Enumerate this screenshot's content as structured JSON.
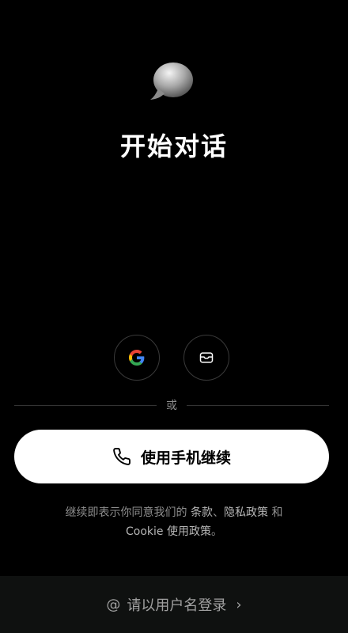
{
  "app": {
    "logo_icon": "chat-bubble-icon",
    "title": "开始对话"
  },
  "social": {
    "google_icon": "google-g-icon",
    "email_icon": "mail-icon"
  },
  "divider": {
    "text": "或"
  },
  "phone_button": {
    "icon": "phone-icon",
    "label": "使用手机继续"
  },
  "terms": {
    "prefix": "继续即表示你同意我们的 ",
    "link_terms": "条款",
    "sep": "、",
    "link_privacy": "隐私政策",
    "and": " 和 ",
    "link_cookie": "Cookie 使用政策",
    "suffix": "。"
  },
  "footer": {
    "at_symbol": "@",
    "label": "请以用户名登录",
    "chevron": "›"
  },
  "colors": {
    "background": "#000000",
    "button_bg": "#ffffff",
    "muted_text": "#8e8e8e",
    "footer_bg": "#0f1110",
    "google_blue": "#4285F4",
    "google_red": "#EA4335",
    "google_yellow": "#FBBC05",
    "google_green": "#34A853"
  }
}
